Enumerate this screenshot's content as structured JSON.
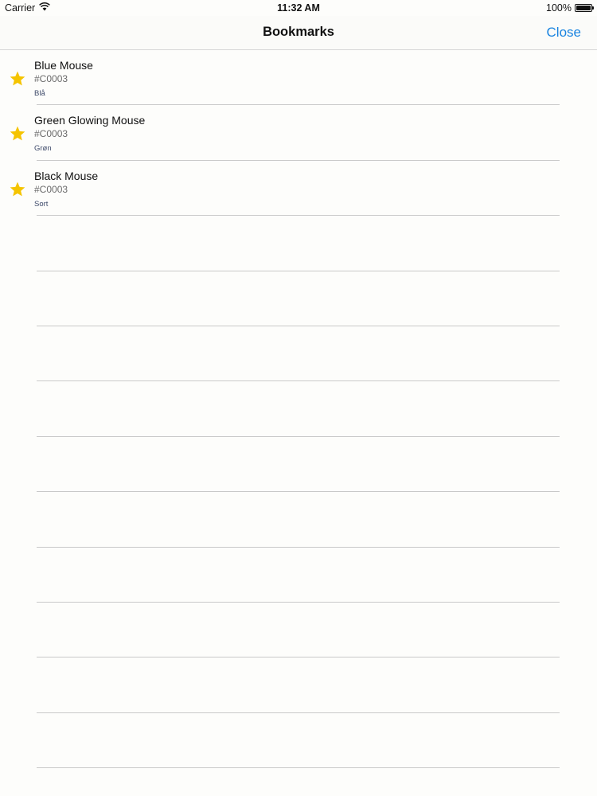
{
  "status_bar": {
    "carrier": "Carrier",
    "time": "11:32 AM",
    "battery_percent": "100%",
    "battery_level": 1.0,
    "icons": [
      "wifi-icon",
      "battery-icon"
    ]
  },
  "nav": {
    "title": "Bookmarks",
    "close_label": "Close"
  },
  "colors": {
    "accent": "#1a84e0",
    "star": "#f5c400",
    "separator": "#c9c9c9",
    "subtitle": "#3e4a6a"
  },
  "bookmarks": [
    {
      "title": "Blue Mouse",
      "code": "#C0003",
      "color_label": "Blå",
      "icon": "star-icon"
    },
    {
      "title": "Green Glowing Mouse",
      "code": "#C0003",
      "color_label": "Grøn",
      "icon": "star-icon"
    },
    {
      "title": "Black Mouse",
      "code": "#C0003",
      "color_label": "Sort",
      "icon": "star-icon"
    }
  ]
}
